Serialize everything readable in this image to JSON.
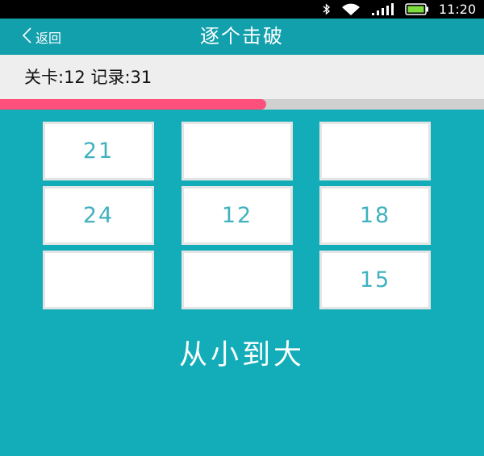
{
  "status_bar": {
    "time": "11:20",
    "icons": [
      "bluetooth-icon",
      "wifi-icon",
      "signal-icon",
      "battery-icon"
    ]
  },
  "nav": {
    "back_label": "返回",
    "title": "逐个击破"
  },
  "info": {
    "text": "关卡:12 记录:31"
  },
  "progress": {
    "fraction": 0.55,
    "color": "#ff4f7b"
  },
  "grid": {
    "tiles": [
      "21",
      "",
      "",
      "24",
      "12",
      "18",
      "",
      "",
      "15"
    ]
  },
  "instruction": "从小到大",
  "colors": {
    "background": "#12adb8",
    "nav_background": "#13a0ad",
    "tile_text": "#3fb1bf",
    "progress": "#ff4f7b"
  }
}
